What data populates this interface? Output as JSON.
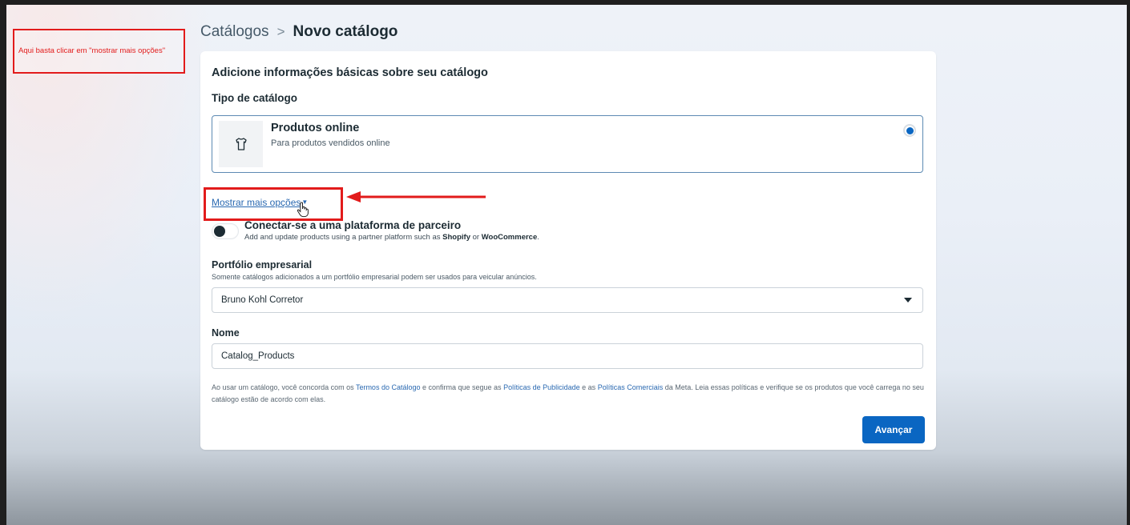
{
  "annotation": {
    "text": "Aqui basta clicar em \"mostrar mais opções\""
  },
  "breadcrumb": {
    "parent": "Catálogos",
    "separator": ">",
    "current": "Novo catálogo"
  },
  "card": {
    "title": "Adicione informações básicas sobre seu catálogo",
    "type_label": "Tipo de catálogo",
    "option": {
      "title": "Produtos online",
      "description": "Para produtos vendidos online",
      "icon": "shirt-icon",
      "selected": true
    },
    "more_options": "Mostrar mais opções",
    "partner": {
      "title": "Conectar-se a uma plataforma de parceiro",
      "desc_prefix": "Add and update products using a partner platform such as",
      "shopify": "Shopify",
      "or": "or",
      "woocommerce": "WooCommerce",
      "suffix": ".",
      "enabled": false
    },
    "portfolio": {
      "label": "Portfólio empresarial",
      "help": "Somente catálogos adicionados a um portfólio empresarial podem ser usados para veicular anúncios.",
      "value": "Bruno Kohl Corretor"
    },
    "name": {
      "label": "Nome",
      "value": "Catalog_Products"
    },
    "legal": {
      "t1": "Ao usar um catálogo, você concorda com os",
      "l1": "Termos do Catálogo",
      "t2": "e confirma que segue as",
      "l2": "Políticas de Publicidade",
      "t3": "e as",
      "l3": "Políticas Comerciais",
      "t4": "da Meta. Leia essas políticas e verifique se os produtos que você carrega no seu catálogo estão de acordo com elas."
    },
    "next_button": "Avançar"
  },
  "colors": {
    "accent": "#0a66c2",
    "annotation_red": "#e21b1b",
    "link": "#2a69b1"
  }
}
